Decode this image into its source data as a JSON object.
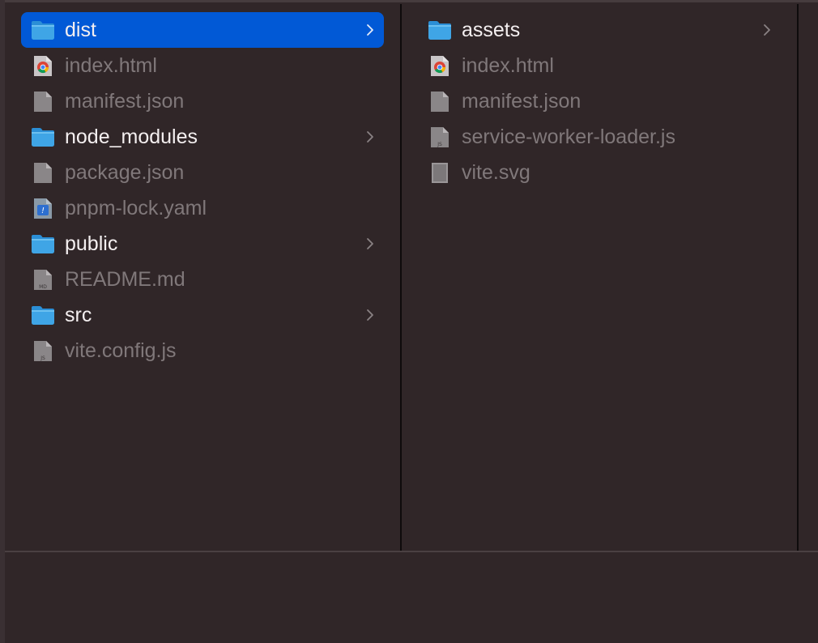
{
  "colors": {
    "background": "#302628",
    "selection": "#0159d6",
    "folder_label": "#f4eff0",
    "file_label": "#80787a",
    "folder_icon": "#3fa5e6"
  },
  "columns": [
    {
      "items": [
        {
          "label": "dist",
          "kind": "folder",
          "icon": "folder-icon",
          "selected": true,
          "chevron": true
        },
        {
          "label": "index.html",
          "kind": "file",
          "icon": "chrome-html-icon"
        },
        {
          "label": "manifest.json",
          "kind": "file",
          "icon": "document-icon"
        },
        {
          "label": "node_modules",
          "kind": "folder",
          "icon": "folder-icon",
          "chevron": true
        },
        {
          "label": "package.json",
          "kind": "file",
          "icon": "document-icon"
        },
        {
          "label": "pnpm-lock.yaml",
          "kind": "file",
          "icon": "yaml-icon"
        },
        {
          "label": "public",
          "kind": "folder",
          "icon": "folder-icon",
          "chevron": true
        },
        {
          "label": "README.md",
          "kind": "file",
          "icon": "markdown-icon",
          "badge": "MD"
        },
        {
          "label": "src",
          "kind": "folder",
          "icon": "folder-icon",
          "chevron": true
        },
        {
          "label": "vite.config.js",
          "kind": "file",
          "icon": "js-file-icon",
          "badge": "JS"
        }
      ]
    },
    {
      "items": [
        {
          "label": "assets",
          "kind": "folder",
          "icon": "folder-icon",
          "chevron": true
        },
        {
          "label": "index.html",
          "kind": "file",
          "icon": "chrome-html-icon"
        },
        {
          "label": "manifest.json",
          "kind": "file",
          "icon": "document-icon"
        },
        {
          "label": "service-worker-loader.js",
          "kind": "file",
          "icon": "js-file-icon",
          "badge": "JS"
        },
        {
          "label": "vite.svg",
          "kind": "file",
          "icon": "svg-file-icon"
        }
      ]
    }
  ]
}
